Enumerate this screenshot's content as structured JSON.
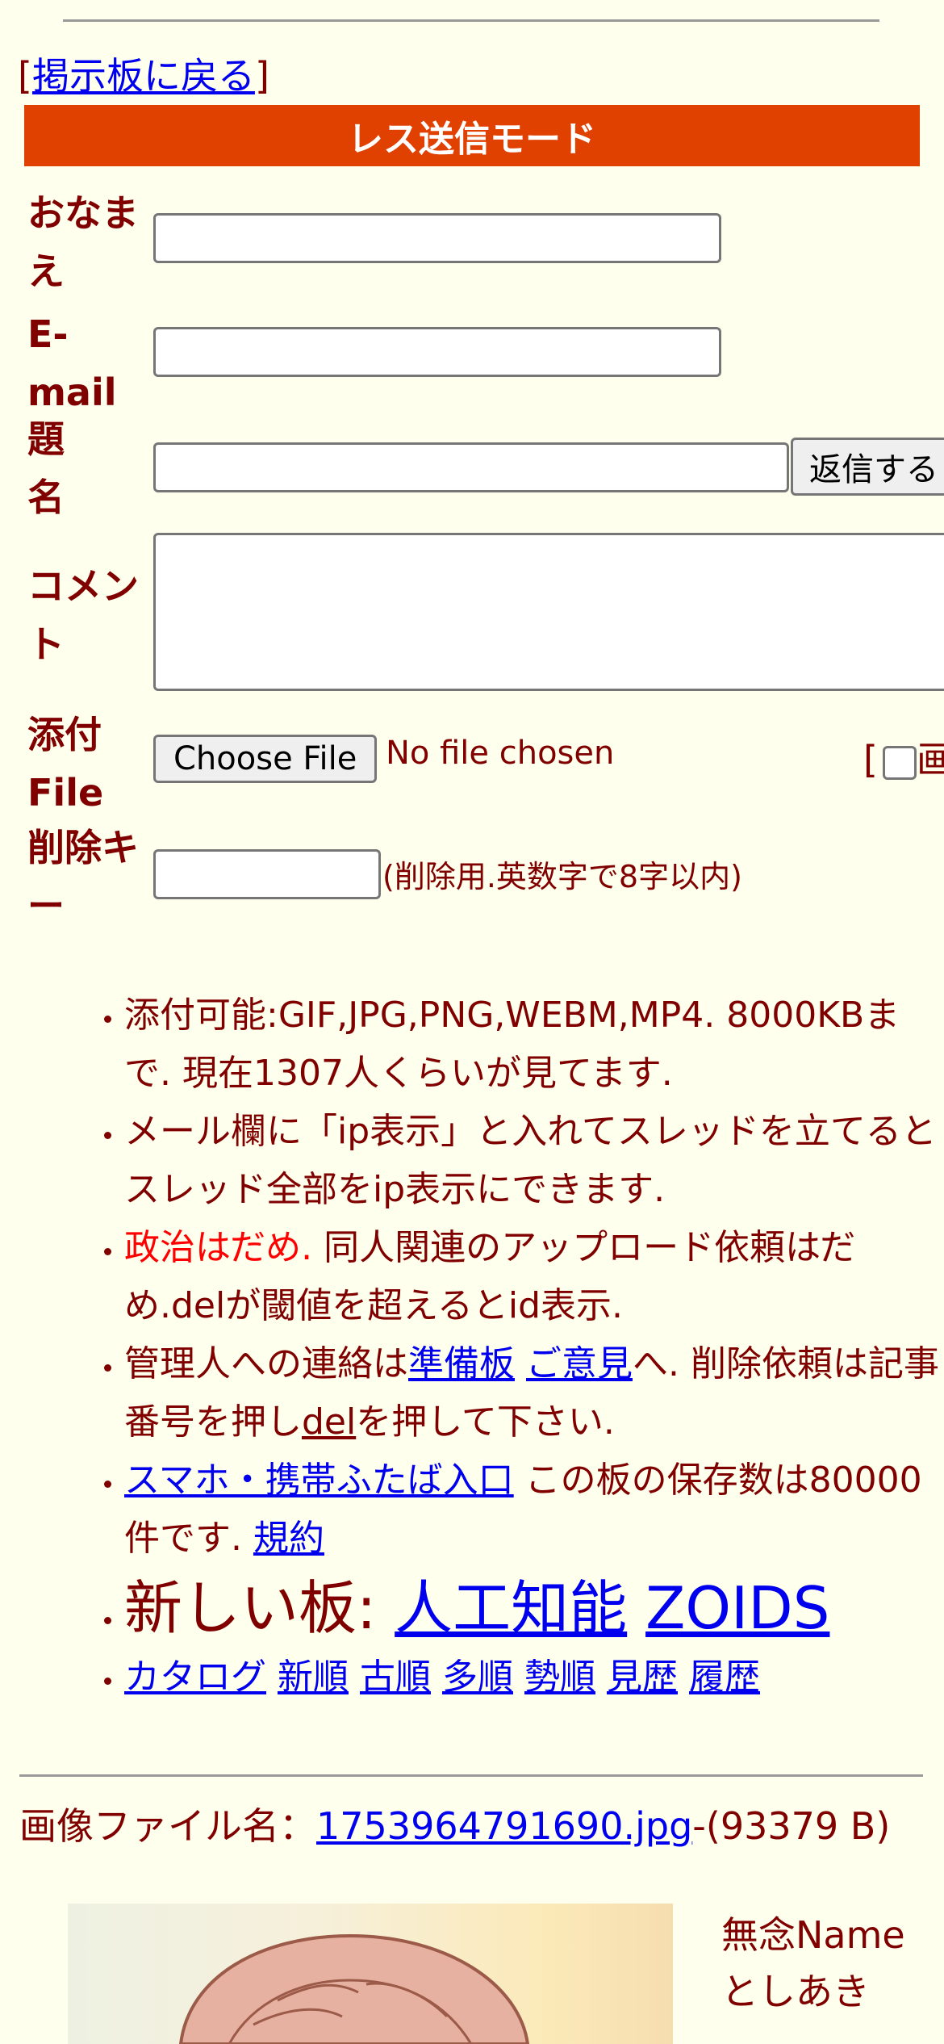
{
  "nav": {
    "bracket_open": "[",
    "back_link": "掲示板に戻る",
    "bracket_close": "]"
  },
  "mode_title": "レス送信モード",
  "form": {
    "name_label": "おなまえ",
    "email_label": "E-mail",
    "subject_label": "題名",
    "submit_label": "返信する",
    "comment_label": "コメント",
    "file_label": "添付File",
    "file_button": "Choose File",
    "file_status": "No file chosen",
    "image_bracket": "[",
    "image_partial": "画",
    "delkey_label": "削除キー",
    "delkey_hint": "(削除用.英数字で8字以内)"
  },
  "notes": {
    "n1": "添付可能:GIF,JPG,PNG,WEBM,MP4. 8000KBまで. 現在1307人くらいが見てます.",
    "n2": "メール欄に「ip表示」と入れてスレッドを立てるとスレッド全部をip表示にできます.",
    "n3_red": "政治はだめ.",
    "n3_rest": " 同人関連のアップロード依頼はだめ.delが閾値を超えるとid表示.",
    "n4_a": "管理人への連絡は",
    "n4_link1": "準備板",
    "n4_link2": "ご意見",
    "n4_b": "へ. 削除依頼は記事番号を押し",
    "n4_del": "del",
    "n4_c": "を押して下さい.",
    "n5_link": "スマホ・携帯ふたば入口",
    "n5_text": " この板の保存数は80000件です. ",
    "n5_rules": "規約",
    "n6_text": "新しい板: ",
    "n6_link1": "人工知能",
    "n6_link2": "ZOIDS",
    "sort_links": [
      "カタログ",
      "新順",
      "古順",
      "多順",
      "勢順",
      "見歴",
      "履歴"
    ]
  },
  "post": {
    "file_label": "画像ファイル名：",
    "file_name": "1753964791690.jpg",
    "file_size": "-(93379 B)",
    "name": "無念Name",
    "author": "としあき"
  }
}
